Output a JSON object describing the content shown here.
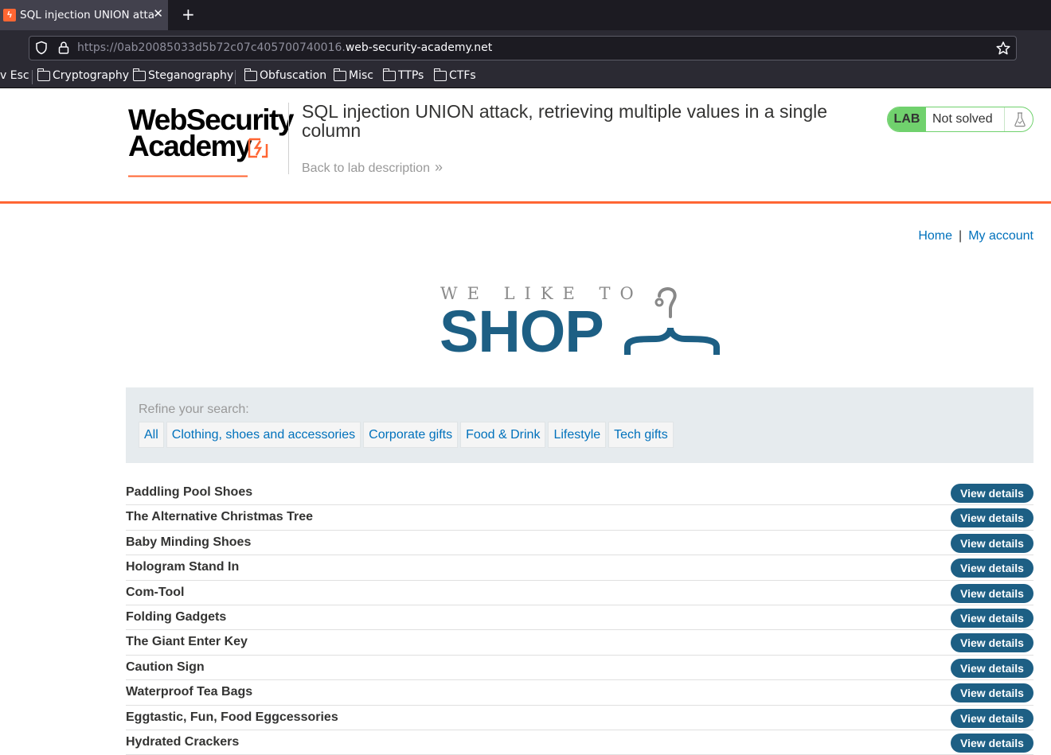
{
  "browser": {
    "tab_title": "SQL injection UNION attack, retrieving multiple values in a single column",
    "url_prefix": "https://0ab20085033d5b72c07c405700740016.",
    "url_domain": "web-security-academy.net",
    "bookmarks": [
      "v Esc",
      "Cryptography",
      "Steganography",
      "Obfuscation",
      "Misc",
      "TTPs",
      "CTFs"
    ]
  },
  "academy": {
    "logo_line1": "WebSecurity",
    "logo_line2": "Academy",
    "lab_title": "SQL injection UNION attack, retrieving multiple values in a single column",
    "back_link": "Back to lab description",
    "lab_badge": "LAB",
    "lab_status": "Not solved",
    "brand_color": "#ff6633",
    "status_color": "#70d16d"
  },
  "nav": {
    "home": "Home",
    "separator": "|",
    "account": "My account"
  },
  "banner": {
    "small": "WE LIKE TO",
    "big": "SHOP"
  },
  "filter": {
    "label": "Refine your search:",
    "categories": [
      "All",
      "Clothing, shoes and accessories",
      "Corporate gifts",
      "Food & Drink",
      "Lifestyle",
      "Tech gifts"
    ]
  },
  "products": [
    "Paddling Pool Shoes",
    "The Alternative Christmas Tree",
    "Baby Minding Shoes",
    "Hologram Stand In",
    "Com-Tool",
    "Folding Gadgets",
    "The Giant Enter Key",
    "Caution Sign",
    "Waterproof Tea Bags",
    "Eggtastic, Fun, Food Eggcessories",
    "Hydrated Crackers"
  ],
  "view_details_label": "View details"
}
